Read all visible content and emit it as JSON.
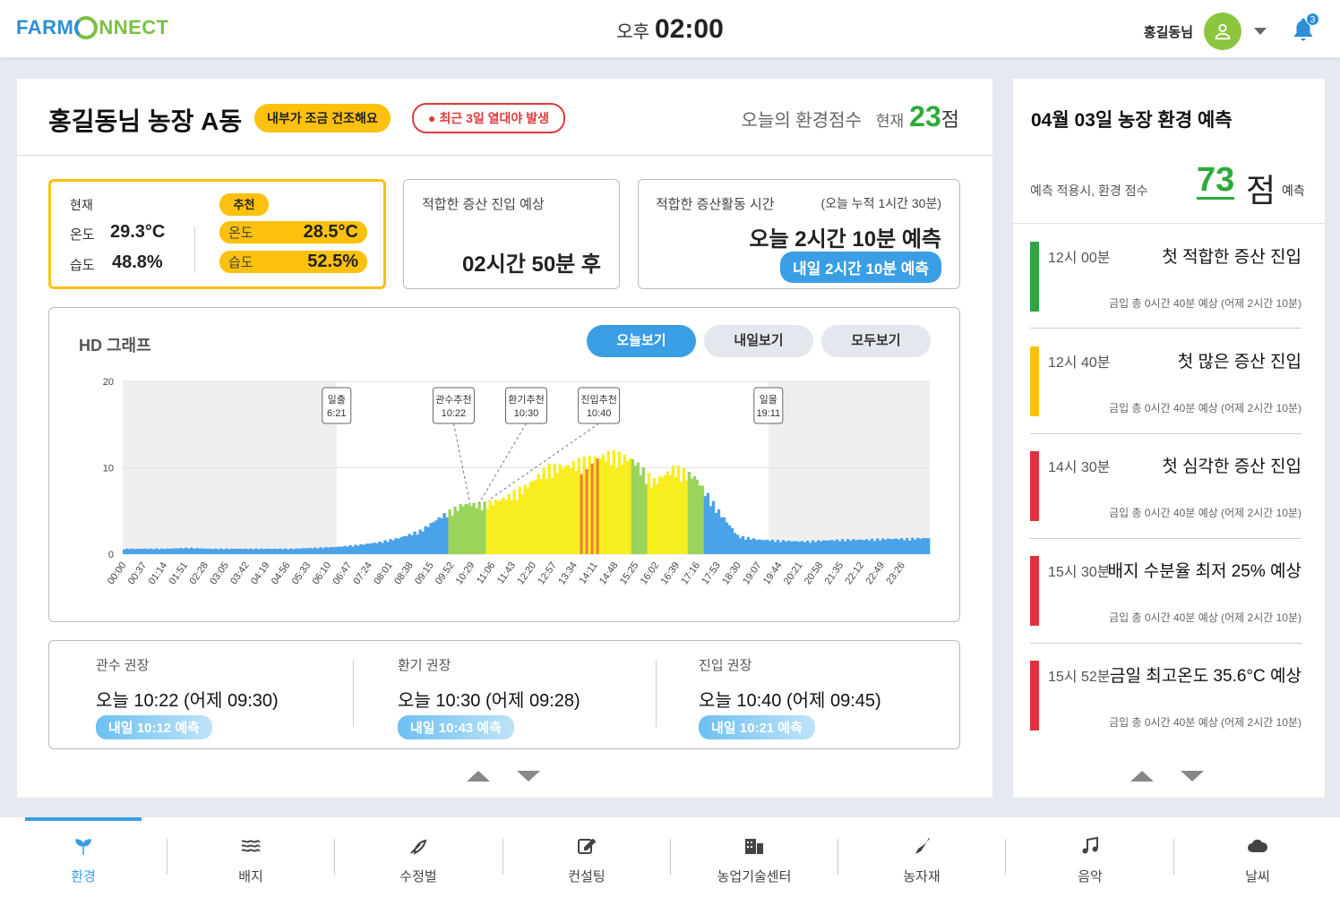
{
  "header": {
    "logo_a": "FARM",
    "logo_b": "NNECT",
    "ampm": "오후",
    "time": "02:00",
    "user": "홍길동님",
    "notif_count": "3"
  },
  "farm": {
    "title": "홍길동님 농장 A동",
    "badge_dry": "내부가 조금 건조해요",
    "badge_heat": "최근 3일 열대야 발생",
    "score_label": "오늘의 환경점수",
    "score_now": "현재",
    "score_value": "23",
    "score_unit": "점"
  },
  "current": {
    "label": "현재",
    "recommend": "추천",
    "temp_label": "온도",
    "temp": "29.3°C",
    "hum_label": "습도",
    "hum": "48.8%",
    "rec_temp": "28.5°C",
    "rec_hum": "52.5%"
  },
  "entry": {
    "title": "적합한 증산 진입 예상",
    "value": "02시간 50분 후"
  },
  "activity": {
    "title": "적합한 증산활동 시간",
    "cumulative": "(오늘 누적 1시간 30분)",
    "today": "오늘 2시간 10분 예측",
    "tomorrow": "내일 2시간 10분 예측"
  },
  "graph": {
    "title": "HD 그래프",
    "buttons": [
      "오늘보기",
      "내일보기",
      "모두보기"
    ]
  },
  "chart_data": {
    "type": "bar",
    "ylim": [
      0,
      20
    ],
    "yticks": [
      "0",
      "10",
      "20"
    ],
    "xticks": [
      "00:00",
      "00:37",
      "01:14",
      "01:51",
      "02:28",
      "03:05",
      "03:42",
      "04:19",
      "04:56",
      "05:33",
      "06:10",
      "06:47",
      "07:24",
      "08:01",
      "08:38",
      "09:15",
      "09:52",
      "10:29",
      "11:06",
      "11:43",
      "12:20",
      "12:57",
      "13:34",
      "14:11",
      "14:48",
      "15:25",
      "16:02",
      "16:39",
      "17:16",
      "17:53",
      "18:30",
      "19:07",
      "19:44",
      "20:21",
      "20:58",
      "21:35",
      "22:12",
      "22:49",
      "23:26"
    ],
    "values": [
      0.6,
      0.6,
      0.6,
      0.7,
      0.6,
      0.6,
      0.6,
      0.6,
      0.6,
      0.7,
      0.8,
      1.0,
      1.3,
      1.8,
      2.6,
      4.2,
      5.5,
      5.5,
      6.2,
      7.5,
      9.5,
      9.8,
      10.5,
      11.0,
      10.5,
      8.0,
      9.5,
      8.5,
      5.0,
      2.0,
      1.6,
      1.5,
      1.4,
      1.5,
      1.6,
      1.6,
      1.7,
      1.7,
      1.8
    ],
    "annotations": [
      {
        "label": "일출",
        "time": "6:21"
      },
      {
        "label": "관수추천",
        "time": "10:22"
      },
      {
        "label": "환기추천",
        "time": "10:30"
      },
      {
        "label": "진입추천",
        "time": "10:40"
      },
      {
        "label": "일몰",
        "time": "19:11"
      }
    ]
  },
  "recommend": [
    {
      "title": "관수 권장",
      "value": "오늘 10:22 (어제 09:30)",
      "tomorrow": "내일 10:12 예측"
    },
    {
      "title": "환기 권장",
      "value": "오늘 10:30 (어제 09:28)",
      "tomorrow": "내일 10:43 예측"
    },
    {
      "title": "진입 권장",
      "value": "오늘 10:40 (어제 09:45)",
      "tomorrow": "내일 10:21 예측"
    }
  ],
  "side": {
    "title": "04월 03일 농장 환경 예측",
    "label": "예측 적용시, 환경 점수",
    "score": "73",
    "unit": "점",
    "suffix": "예측",
    "events": [
      {
        "time": "12시 00분",
        "title": "첫 적합한 증산 진입",
        "desc": "금입 총 0시간 40분 예상 (어제 2시간 10분)",
        "color": "#2da640"
      },
      {
        "time": "12시 40분",
        "title": "첫 많은 증산 진입",
        "desc": "금입 총 0시간 40분 예상 (어제 2시간 10분)",
        "color": "#fcc10e"
      },
      {
        "time": "14시 30분",
        "title": "첫 심각한 증산 진입",
        "desc": "금입 총 0시간 40분 예상 (어제 2시간 10분)",
        "color": "#e0323c"
      },
      {
        "time": "15시 30분",
        "title": "배지 수분율 최저 25% 예상",
        "desc": "금입 총 0시간 40분 예상 (어제 2시간 10분)",
        "color": "#e0323c"
      },
      {
        "time": "15시 52분",
        "title": "금일 최고온도 35.6°C 예상",
        "desc": "금입 총 0시간 40분 예상 (어제 2시간 10분)",
        "color": "#e0323c"
      }
    ]
  },
  "nav": [
    "환경",
    "배지",
    "수정벌",
    "컨설팅",
    "농업기술센터",
    "농자재",
    "음악",
    "날씨"
  ]
}
